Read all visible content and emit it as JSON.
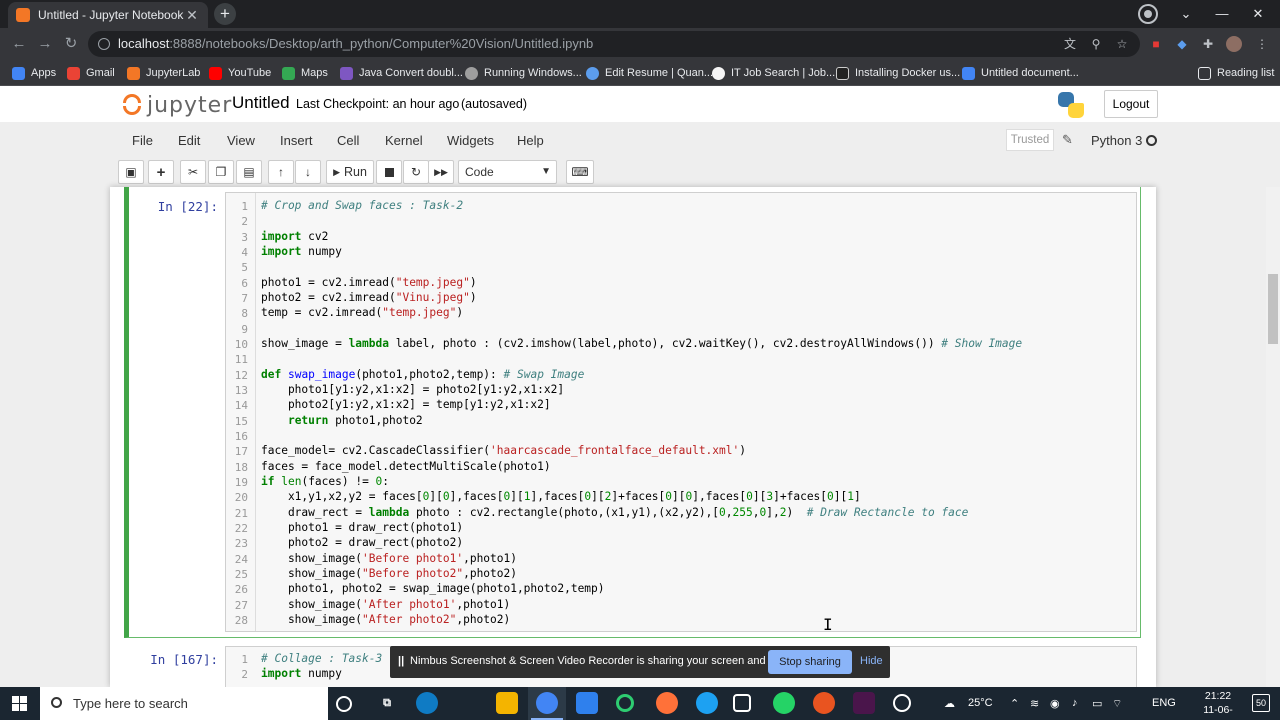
{
  "browser": {
    "tab_title": "Untitled - Jupyter Notebook",
    "url_host": "localhost",
    "url_rest": ":8888/notebooks/Desktop/arth_python/Computer%20Vision/Untitled.ipynb",
    "bookmarks": [
      "Apps",
      "Gmail",
      "JupyterLab",
      "YouTube",
      "Maps",
      "Java Convert doubl...",
      "Running Windows...",
      "Edit Resume | Quan...",
      "IT Job Search | Job...",
      "Installing Docker us...",
      "Untitled document..."
    ],
    "reading_list": "Reading list"
  },
  "jupyter": {
    "logo_text": "jupyter",
    "notebook_name": "Untitled",
    "checkpoint": "Last Checkpoint: an hour ago",
    "autosaved": "(autosaved)",
    "logout": "Logout",
    "menus": [
      "File",
      "Edit",
      "View",
      "Insert",
      "Cell",
      "Kernel",
      "Widgets",
      "Help"
    ],
    "trusted": "Trusted",
    "kernel_name": "Python 3",
    "run_label": "Run",
    "cell_type": "Code"
  },
  "cells": [
    {
      "prompt": "In [22]:",
      "line_numbers": [
        "1",
        "2",
        "3",
        "4",
        "5",
        "6",
        "7",
        "8",
        "9",
        "10",
        "11",
        "12",
        "13",
        "14",
        "15",
        "16",
        "17",
        "18",
        "19",
        "20",
        "21",
        "22",
        "23",
        "24",
        "25",
        "26",
        "27",
        "28"
      ]
    },
    {
      "prompt": "In [167]:",
      "line_numbers": [
        "1",
        "2"
      ]
    }
  ],
  "share_bar": {
    "message": "Nimbus Screenshot & Screen Video Recorder is sharing your screen and audio.",
    "stop": "Stop sharing",
    "hide": "Hide"
  },
  "taskbar": {
    "search_placeholder": "Type here to search",
    "temperature": "25°C",
    "language": "ENG",
    "time": "21:22",
    "date": "11-06-2021",
    "notifications": "50"
  }
}
